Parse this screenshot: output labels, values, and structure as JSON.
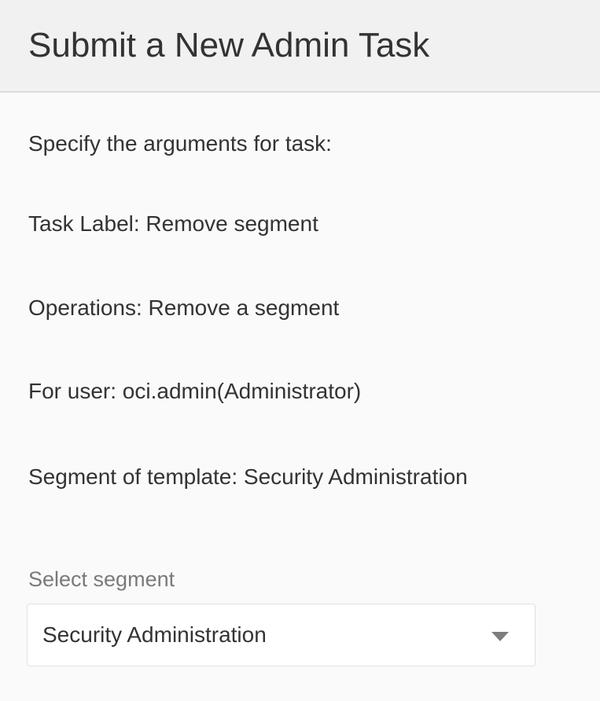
{
  "header": {
    "title": "Submit a New Admin Task"
  },
  "content": {
    "intro": "Specify the arguments for task:",
    "task_label": "Task Label: Remove segment",
    "operations": "Operations: Remove a segment",
    "for_user": "For user: oci.admin(Administrator)",
    "segment_template": "Segment of template: Security Administration"
  },
  "segment_select": {
    "label": "Select segment",
    "selected_value": "Security Administration",
    "arrow_icon": "chevron-down-icon"
  },
  "colors": {
    "page_background": "#fafafa",
    "header_background": "#f1f1f1",
    "header_border": "#dcdcdc",
    "text": "#333333",
    "muted_label": "#7a7a7a"
  }
}
